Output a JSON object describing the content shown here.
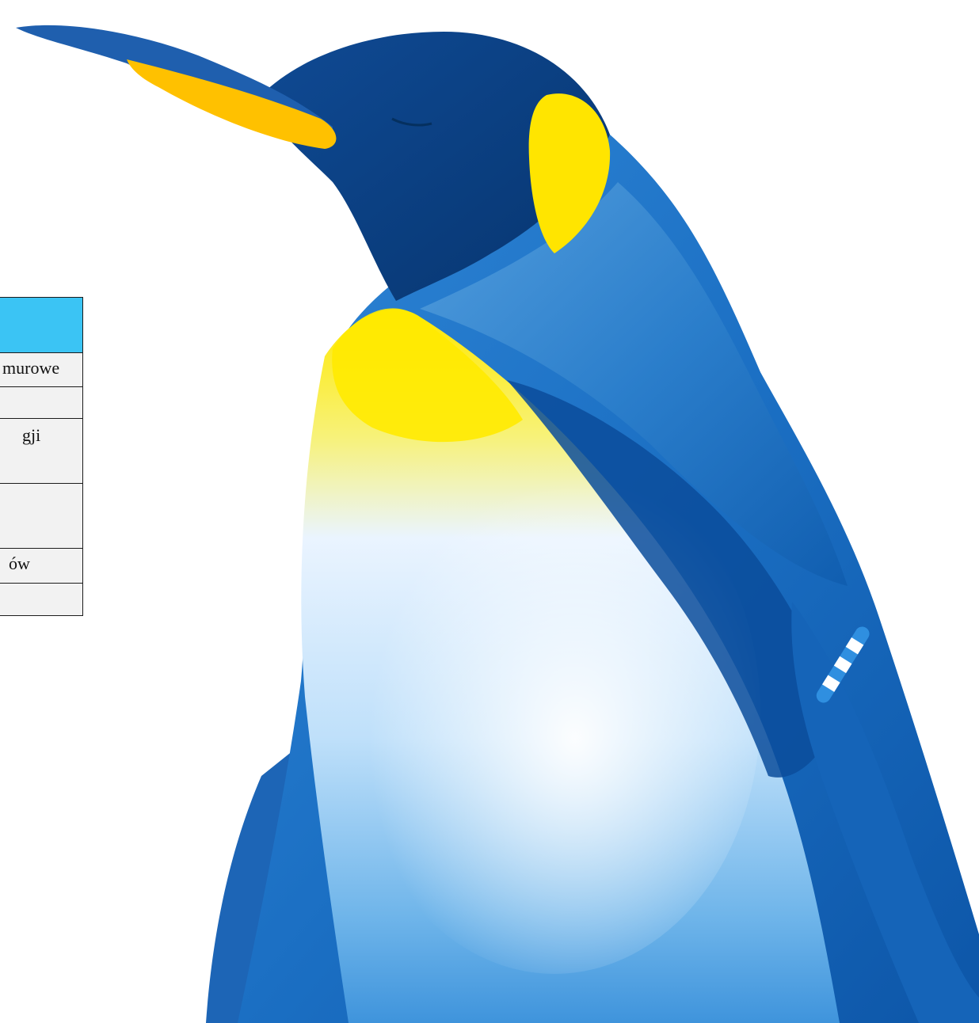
{
  "table": {
    "rows": [
      {
        "text": "murowe"
      },
      {
        "text": ""
      },
      {
        "text": "gji"
      },
      {
        "text": ""
      },
      {
        "text": "ów"
      },
      {
        "text": ""
      }
    ]
  },
  "illustration": {
    "subject": "penguin-icon",
    "colors": {
      "dark_head": "#0b3f86",
      "body_blue": "#1a6ec2",
      "light_blue": "#4aa3e3",
      "belly_white": "#f4f8fc",
      "yellow": "#ffe500",
      "table_header": "#3bc4f4"
    }
  }
}
